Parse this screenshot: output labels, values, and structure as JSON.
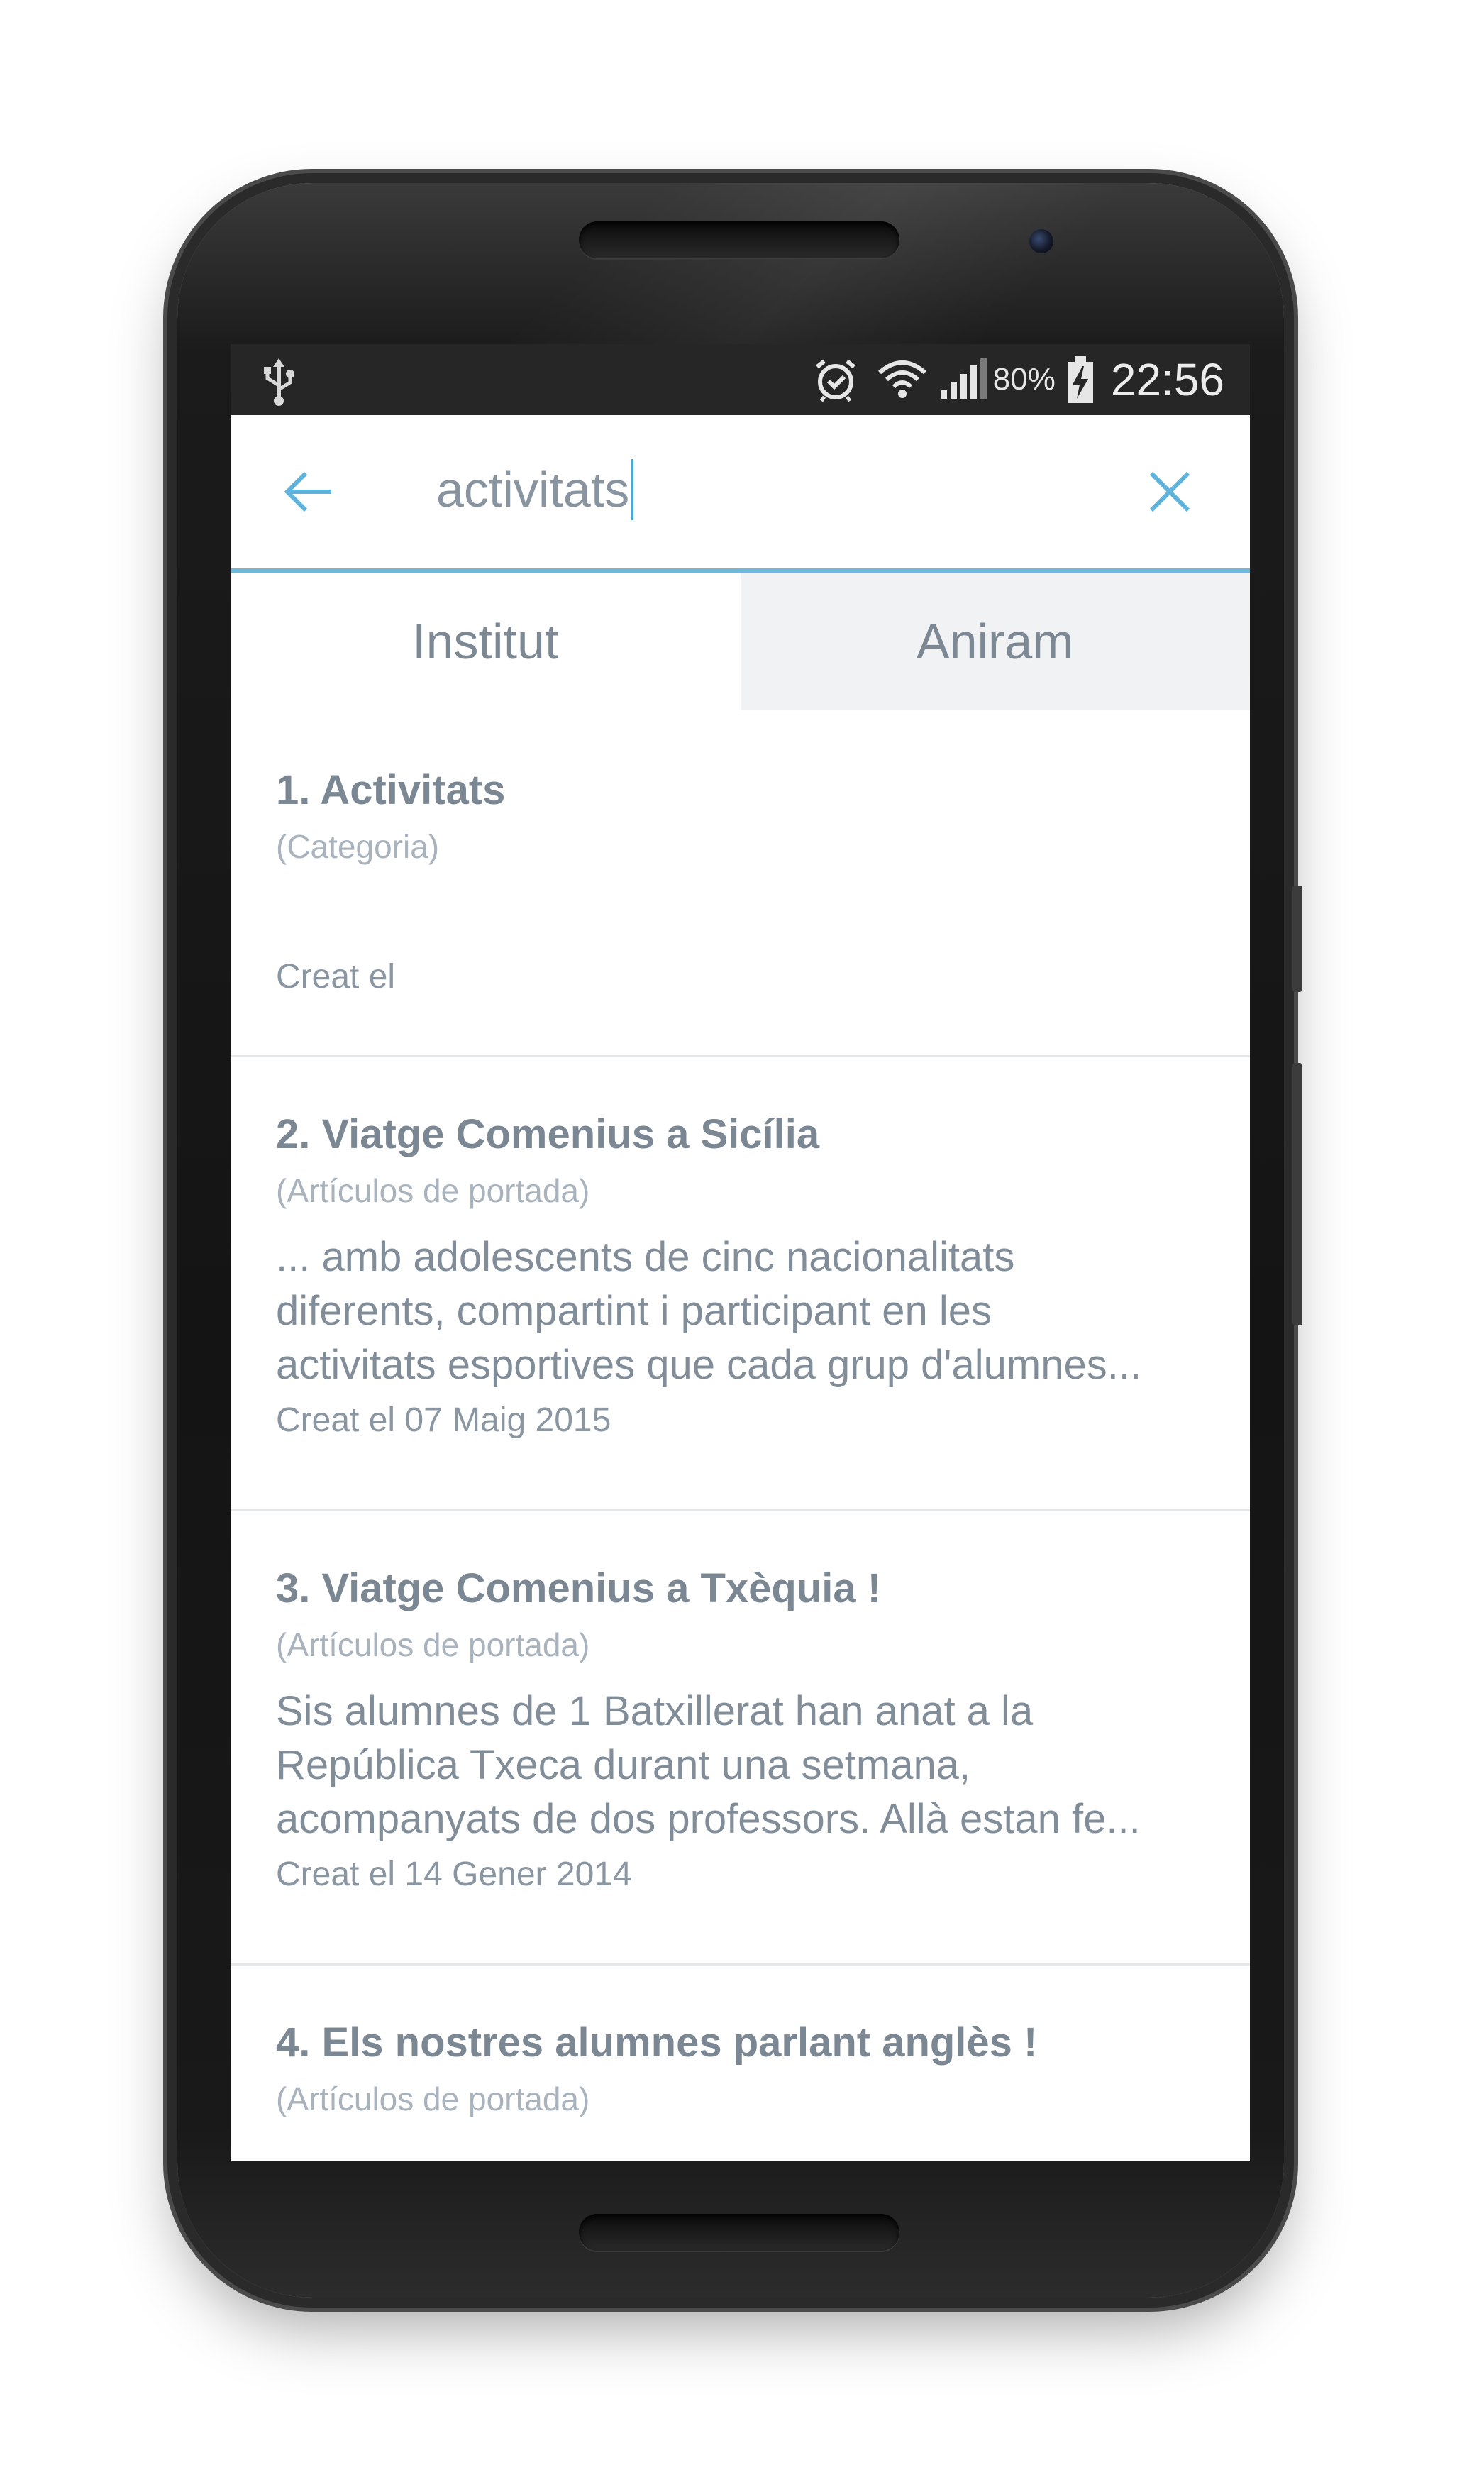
{
  "status_bar": {
    "icons": [
      "usb-icon",
      "alarm-icon",
      "wifi-icon",
      "signal-icon",
      "battery-charging-icon"
    ],
    "battery_percent": "80%",
    "clock": "22:56"
  },
  "search": {
    "query": "activitats",
    "back_icon": "arrow-left-icon",
    "clear_icon": "close-icon",
    "accent_color": "#6fb8d9"
  },
  "tabs": [
    {
      "label": "Institut",
      "selected": true
    },
    {
      "label": "Aniram",
      "selected": false
    }
  ],
  "results": [
    {
      "title": "1. Activitats",
      "category": "(Categoria)",
      "snippet": "",
      "created": "Creat el"
    },
    {
      "title": "2. Viatge Comenius a Sicília",
      "category": "(Artículos de portada)",
      "snippet_lines": [
        "... amb adolescents de cinc nacionalitats",
        "diferents, compartint i participant en les",
        "activitats esportives que cada grup d'alumnes..."
      ],
      "created": "Creat el 07 Maig 2015"
    },
    {
      "title": "3. Viatge Comenius a Txèquia !",
      "category": "(Artículos de portada)",
      "snippet_lines": [
        "Sis alumnes de 1 Batxillerat han anat a la",
        "República Txeca durant una setmana,",
        "acompanyats de dos professors. Allà estan fe..."
      ],
      "created": "Creat el 14 Gener 2014"
    },
    {
      "title": "4. Els nostres alumnes parlant anglès !",
      "category": "(Artículos de portada)"
    }
  ]
}
